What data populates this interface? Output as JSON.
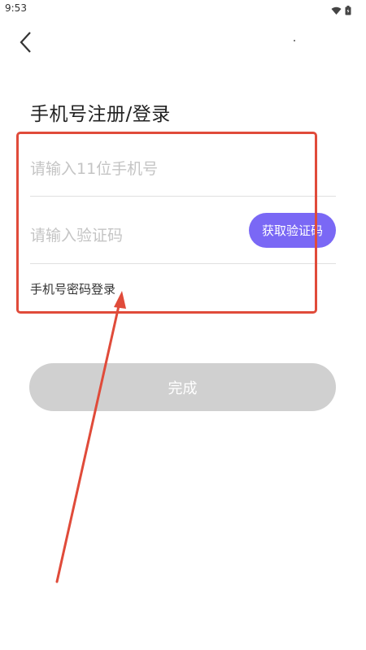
{
  "status_bar": {
    "time": "9:53",
    "icons": [
      "wifi-icon",
      "battery-icon"
    ]
  },
  "header": {
    "back_icon": "chevron-left-icon"
  },
  "form": {
    "title": "手机号注册/登录",
    "phone": {
      "value": "",
      "placeholder": "请输入11位手机号"
    },
    "code": {
      "value": "",
      "placeholder": "请输入验证码"
    },
    "get_code_label": "获取验证码",
    "password_login_label": "手机号密码登录"
  },
  "actions": {
    "done_label": "完成"
  },
  "annotation": {
    "highlight_color": "#e04b3a"
  },
  "colors": {
    "accent": "#7a68f5",
    "disabled_button": "#d0d0d0"
  }
}
